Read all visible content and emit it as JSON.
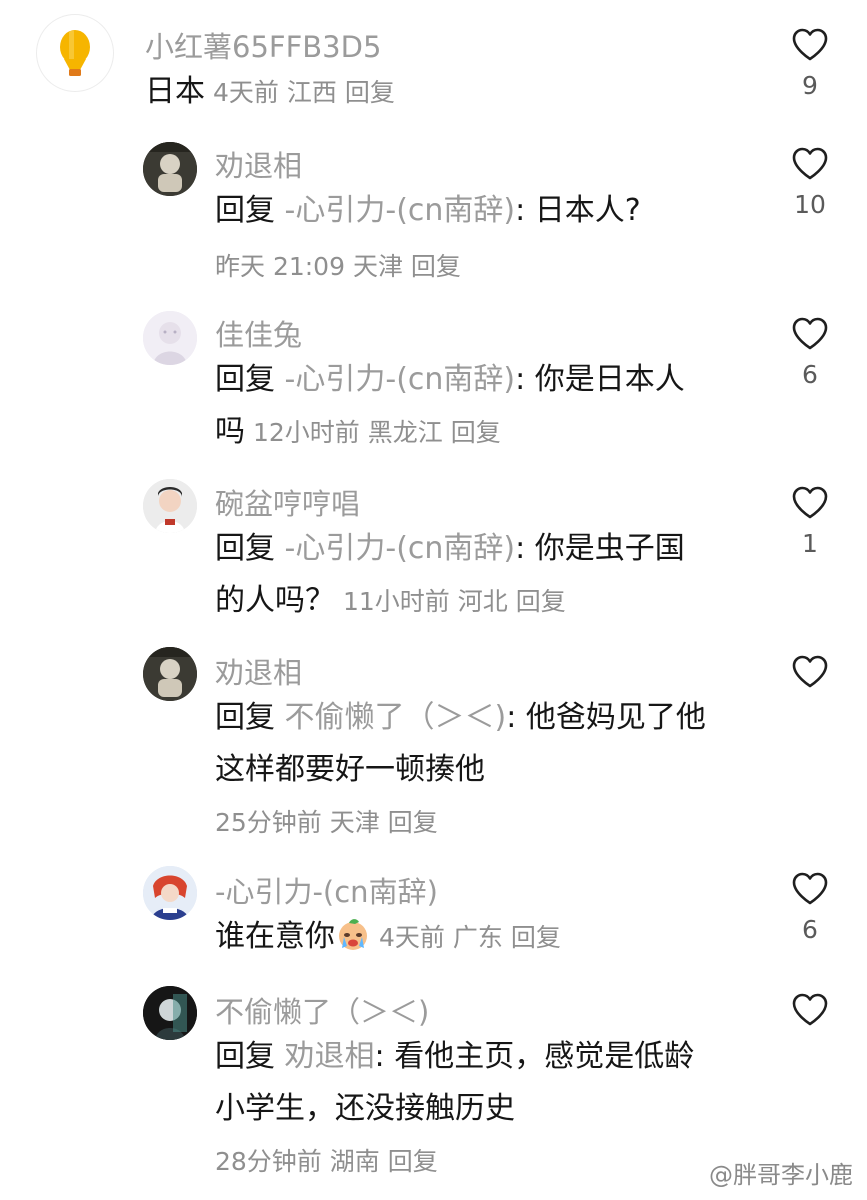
{
  "comments": [
    {
      "username": "小红薯65FFB3D5",
      "text": "日本",
      "time": "4天前",
      "location": "江西",
      "reply_label": "回复",
      "likes": "9"
    },
    {
      "username": "劝退相",
      "reply_prefix": "回复",
      "reply_target": "-心引力-(cn南辞)",
      "text": ": 日本人?",
      "time": "昨天 21:09",
      "location": "天津",
      "reply_label": "回复",
      "likes": "10"
    },
    {
      "username": "佳佳兔",
      "reply_prefix": "回复",
      "reply_target": "-心引力-(cn南辞)",
      "text": ": 你是日本人",
      "text2": "吗",
      "time": "12小时前",
      "location": "黑龙江",
      "reply_label": "回复",
      "likes": "6"
    },
    {
      "username": "碗盆哼哼唱",
      "reply_prefix": "回复",
      "reply_target": "-心引力-(cn南辞)",
      "text": ": 你是虫子国",
      "text2": "的人吗？",
      "time": "11小时前",
      "location": "河北",
      "reply_label": "回复",
      "likes": "1"
    },
    {
      "username": "劝退相",
      "reply_prefix": "回复",
      "reply_target": "不偷懒了（＞＜)",
      "text": ": 他爸妈见了他",
      "text2": "这样都要好一顿揍他",
      "time": "25分钟前",
      "location": "天津",
      "reply_label": "回复",
      "likes": ""
    },
    {
      "username": "-心引力-(cn南辞)",
      "text": "谁在意你",
      "time": "4天前",
      "location": "广东",
      "reply_label": "回复",
      "likes": "6"
    },
    {
      "username": "不偷懒了（＞＜)",
      "reply_prefix": "回复",
      "reply_target": "劝退相",
      "text": ": 看他主页，感觉是低龄",
      "text2": "小学生，还没接触历史",
      "time": "28分钟前",
      "location": "湖南",
      "reply_label": "回复",
      "likes": ""
    }
  ],
  "watermark": "@胖哥李小鹿",
  "icons": {
    "like": "heart-outline-icon",
    "top_avatar": "hot-air-balloon-icon",
    "emoji": "crying-face-emoji"
  },
  "colors": {
    "username": "#9b9b9b",
    "text": "#161616",
    "meta": "#8f8f8f",
    "balloon": "#f5b400"
  }
}
